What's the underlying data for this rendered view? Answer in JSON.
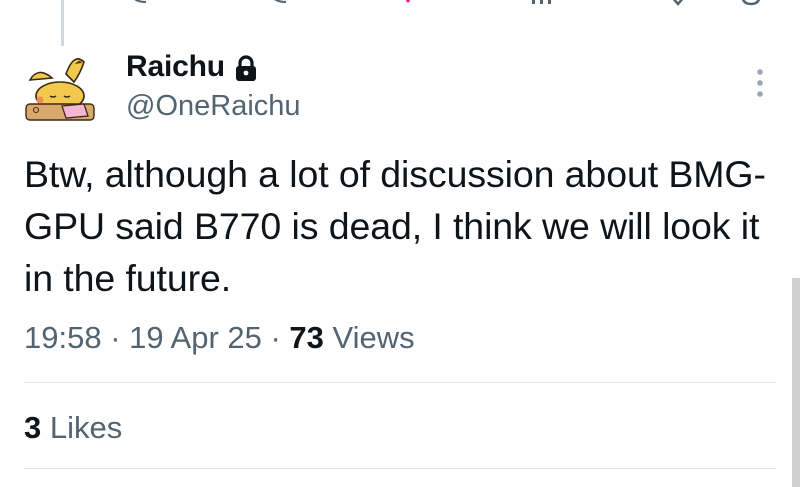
{
  "tweet": {
    "author": {
      "display_name": "Raichu",
      "handle": "@OneRaichu",
      "protected_icon": "lock-icon",
      "avatar_icon": "raichu-avatar"
    },
    "text": "Btw, although a lot of discussion about BMG-GPU said B770 is dead, I think we will look it in the future.",
    "meta": {
      "time": "19:58",
      "separator": " · ",
      "date": "19 Apr 25",
      "views_count": "73",
      "views_label": "Views"
    },
    "engagement": {
      "likes_count": "3",
      "likes_label": "Likes"
    }
  },
  "colors": {
    "text_primary": "#0f1419",
    "text_secondary": "#536471",
    "divider": "#e1e8ed"
  }
}
